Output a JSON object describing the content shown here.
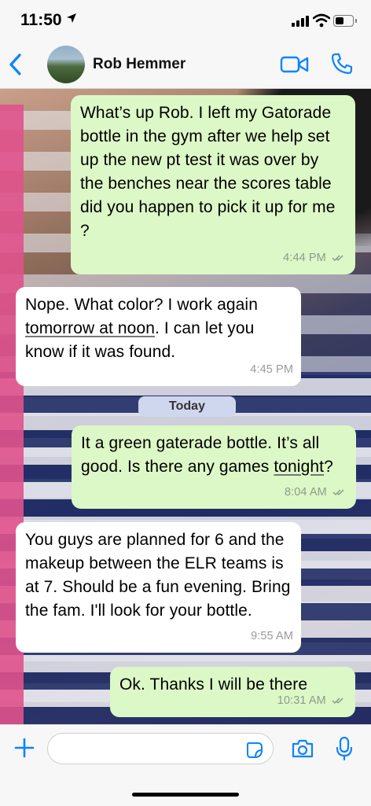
{
  "status_bar": {
    "time": "11:50",
    "location_arrow": "location-arrow-icon"
  },
  "header": {
    "contact_name": "Rob Hemmer"
  },
  "messages": [
    {
      "dir": "out",
      "text": "What’s up Rob. I left my Gatorade bottle in the gym after we help set up the new pt test it was over by the benches near the scores table did you happen to pick it up for me ?",
      "time": "4:44 PM",
      "read": true
    },
    {
      "dir": "in",
      "text_a": "Nope. What color? I work again ",
      "text_link": "tomorrow at noon",
      "text_b": ". I can let you know if it was found.",
      "time": "4:45 PM"
    },
    {
      "dir": "out",
      "text_a": "It a green gaterade bottle. It’s all good. Is there any games ",
      "text_link": "tonight",
      "text_b": "?",
      "time": "8:04 AM",
      "read": true
    },
    {
      "dir": "in",
      "text": "You guys are planned for 6 and the makeup between the ELR teams is at 7. Should be a fun evening. Bring the fam. I'll look for your bottle.",
      "time": "9:55 AM"
    },
    {
      "dir": "out",
      "text": "Ok. Thanks I will be there",
      "time": "10:31 AM",
      "read": true
    }
  ],
  "date_separator": "Today",
  "composer": {
    "placeholder": ""
  },
  "colors": {
    "accent": "#0a84ff",
    "outgoing_bubble": "#dcf8c6",
    "incoming_bubble": "#ffffff"
  }
}
